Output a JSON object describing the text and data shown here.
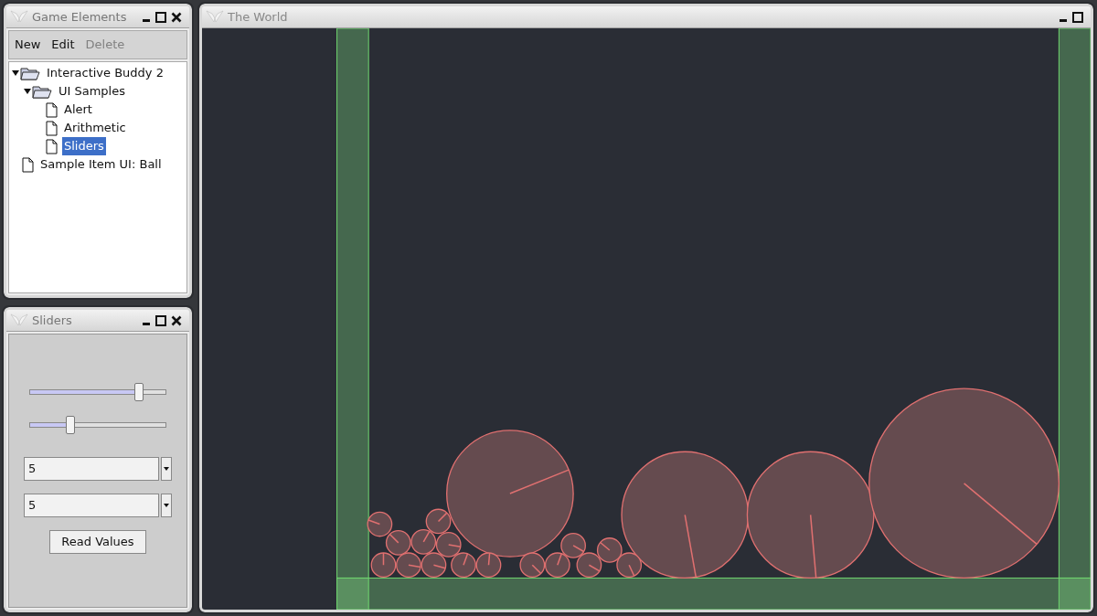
{
  "elements_window": {
    "title": "Game Elements",
    "closable": true,
    "menu": [
      {
        "label": "New",
        "disabled": false
      },
      {
        "label": "Edit",
        "disabled": false
      },
      {
        "label": "Delete",
        "disabled": true
      }
    ],
    "tree": [
      {
        "label": "Interactive Buddy 2",
        "kind": "folder",
        "expanded": true,
        "selected": false,
        "children": [
          {
            "label": "UI Samples",
            "kind": "folder",
            "expanded": true,
            "selected": false,
            "children": [
              {
                "label": "Alert",
                "kind": "file",
                "selected": false
              },
              {
                "label": "Arithmetic",
                "kind": "file",
                "selected": false
              },
              {
                "label": "Sliders",
                "kind": "file",
                "selected": true
              }
            ]
          }
        ]
      },
      {
        "label": "Sample Item UI: Ball",
        "kind": "file",
        "selected": false
      }
    ]
  },
  "sliders_window": {
    "title": "Sliders",
    "closable": true,
    "sliders": [
      {
        "level": 0.8
      },
      {
        "level": 0.3
      }
    ],
    "dropdowns": [
      {
        "value": "5"
      },
      {
        "value": "5"
      }
    ],
    "button": "Read Values"
  },
  "world_window": {
    "title": "The World",
    "closable": false
  }
}
